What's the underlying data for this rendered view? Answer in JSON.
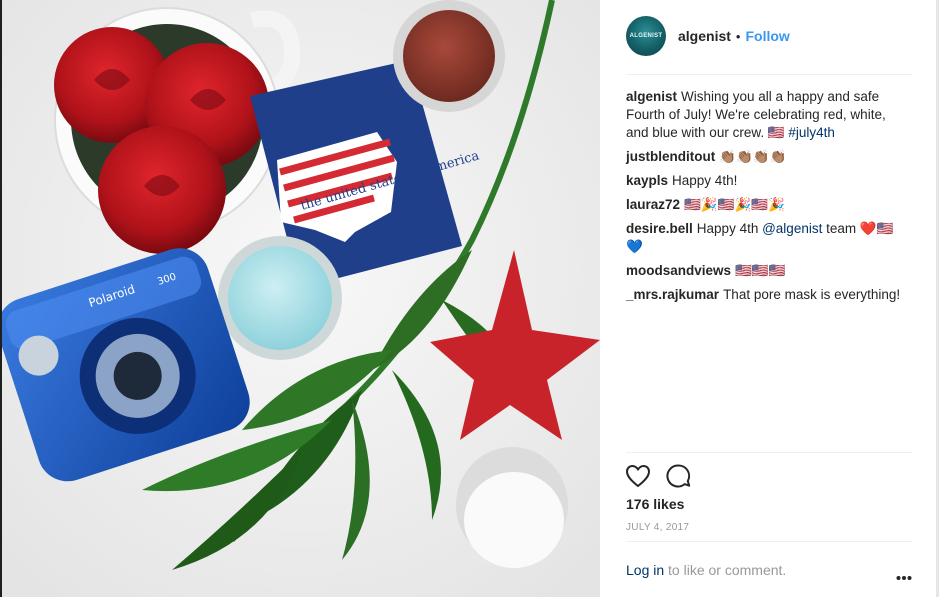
{
  "post": {
    "username": "algenist",
    "follow_label": "Follow",
    "avatar_text": "ALGENIST",
    "separator": "•",
    "caption": {
      "user": "algenist",
      "text": "Wishing you all a happy and safe Fourth of July! We're celebrating red, white, and blue with our crew. 🇺🇸 ",
      "hashtag": "#july4th"
    },
    "comments": [
      {
        "user": "justblenditout",
        "text": "👏🏽👏🏽👏🏽👏🏽"
      },
      {
        "user": "kaypls",
        "text": "Happy 4th!"
      },
      {
        "user": "lauraz72",
        "text": "🇺🇸🎉🇺🇸🎉🇺🇸🎉"
      },
      {
        "user": "desire.bell",
        "text_before": "Happy 4th ",
        "mention": "@algenist",
        "text_after": " team ❤️🇺🇸💙"
      },
      {
        "user": "moodsandviews",
        "text": "🇺🇸🇺🇸🇺🇸"
      },
      {
        "user": "_mrs.rajkumar",
        "text": "That pore mask is everything!"
      }
    ],
    "likes": "176 likes",
    "date": "JULY 4, 2017",
    "login_link": "Log in",
    "login_rest": " to like or comment.",
    "more_icon": "more-options-icon",
    "napkin_text": "the united states of america",
    "camera_brand": "Polaroid",
    "camera_model": "300"
  }
}
